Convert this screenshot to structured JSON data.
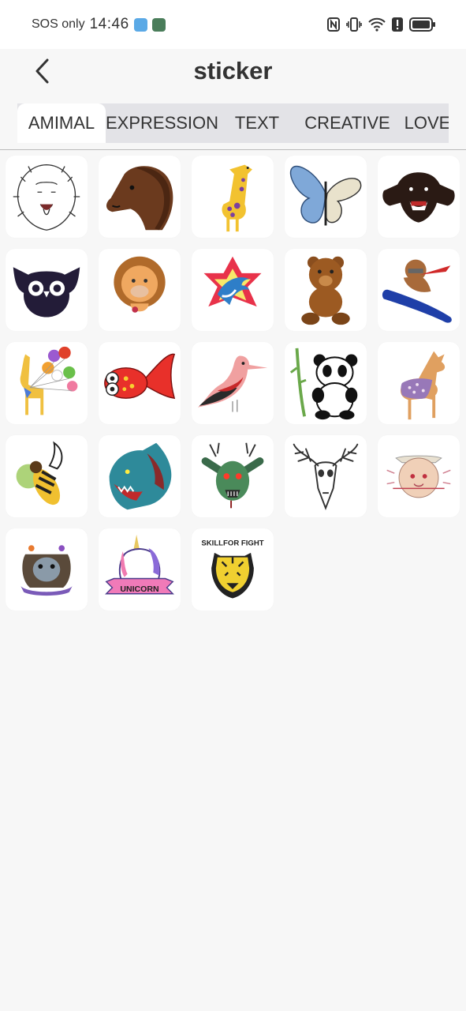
{
  "status": {
    "carrier": "SOS only",
    "time": "14:46"
  },
  "header": {
    "title": "sticker"
  },
  "tabs": [
    {
      "label": "AMIMAL",
      "active": true
    },
    {
      "label": "EXPRESSION",
      "active": false
    },
    {
      "label": "TEXT",
      "active": false
    },
    {
      "label": "CREATIVE",
      "active": false
    },
    {
      "label": "LOVE",
      "active": false
    }
  ],
  "stickers": [
    {
      "icon": "lion-sticker"
    },
    {
      "icon": "horse-sticker"
    },
    {
      "icon": "giraffe-sticker"
    },
    {
      "icon": "butterfly-sticker"
    },
    {
      "icon": "bear-sticker"
    },
    {
      "icon": "owl-sticker"
    },
    {
      "icon": "lion-cub-sticker"
    },
    {
      "icon": "dolphin-star-sticker"
    },
    {
      "icon": "teddy-bear-sticker"
    },
    {
      "icon": "snowboard-bear-sticker"
    },
    {
      "icon": "giraffe-balloons-sticker"
    },
    {
      "icon": "goldfish-sticker"
    },
    {
      "icon": "bird-sticker"
    },
    {
      "icon": "panda-sticker"
    },
    {
      "icon": "deer-sticker"
    },
    {
      "icon": "wasp-sticker"
    },
    {
      "icon": "monster-wolf-sticker"
    },
    {
      "icon": "zombie-rabbit-sticker"
    },
    {
      "icon": "deer-skull-sticker"
    },
    {
      "icon": "cat-cowboy-sticker"
    },
    {
      "icon": "bulldog-sticker"
    },
    {
      "icon": "unicorn-sticker",
      "text": "UNICORN"
    },
    {
      "icon": "tiger-sticker",
      "text": "SKILLFOR FIGHT"
    }
  ]
}
